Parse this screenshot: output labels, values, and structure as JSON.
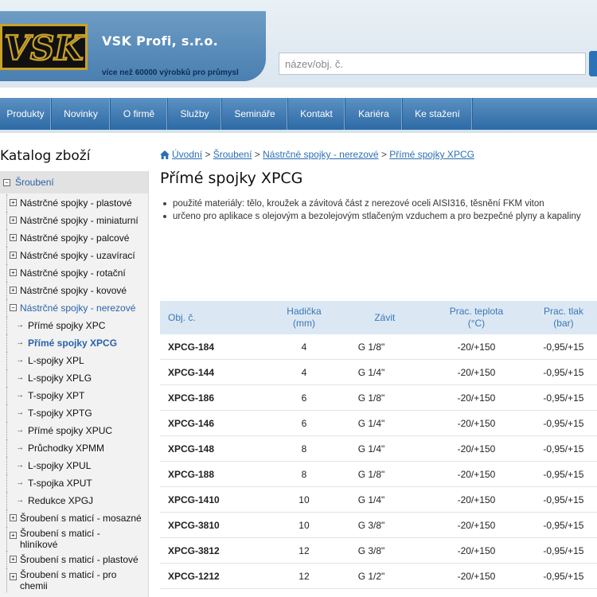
{
  "header": {
    "brand_title": "VSK Profi, s.r.o.",
    "tagline": "více než 60000 výrobků pro průmysl",
    "logo_text": "VSK",
    "search_placeholder": "název/obj. č."
  },
  "nav": [
    "Produkty",
    "Novinky",
    "O firmě",
    "Služby",
    "Semináře",
    "Kontakt",
    "Kariéra",
    "Ke stažení"
  ],
  "sidebar": {
    "title": "Katalog zboží",
    "root": "Šroubení",
    "items": [
      {
        "label": "Nástrčné spojky - plastové",
        "level": 1,
        "state": "normal"
      },
      {
        "label": "Nástrčné spojky - miniaturní",
        "level": 1,
        "state": "normal"
      },
      {
        "label": "Nástrčné spojky - palcové",
        "level": 1,
        "state": "normal"
      },
      {
        "label": "Nástrčné spojky - uzavírací",
        "level": 1,
        "state": "normal"
      },
      {
        "label": "Nástrčné spojky - rotační",
        "level": 1,
        "state": "normal"
      },
      {
        "label": "Nástrčné spojky - kovové",
        "level": 1,
        "state": "normal"
      },
      {
        "label": "Nástrčné spojky - nerezové",
        "level": 1,
        "state": "active"
      },
      {
        "label": "Přímé spojky XPC",
        "level": 2,
        "state": "normal"
      },
      {
        "label": "Přímé spojky XPCG",
        "level": 2,
        "state": "current"
      },
      {
        "label": "L-spojky XPL",
        "level": 2,
        "state": "normal"
      },
      {
        "label": "L-spojky XPLG",
        "level": 2,
        "state": "normal"
      },
      {
        "label": "T-spojky XPT",
        "level": 2,
        "state": "normal"
      },
      {
        "label": "T-spojky XPTG",
        "level": 2,
        "state": "normal"
      },
      {
        "label": "Přímé spojky XPUC",
        "level": 2,
        "state": "normal"
      },
      {
        "label": "Průchodky XPMM",
        "level": 2,
        "state": "normal"
      },
      {
        "label": "L-spojky XPUL",
        "level": 2,
        "state": "normal"
      },
      {
        "label": "T-spojka XPUT",
        "level": 2,
        "state": "normal"
      },
      {
        "label": "Redukce XPGJ",
        "level": 2,
        "state": "normal"
      },
      {
        "label": "Šroubení s maticí - mosazné",
        "level": 1,
        "state": "normal"
      },
      {
        "label": "Šroubení s maticí - hliníkové",
        "level": 1,
        "state": "normal"
      },
      {
        "label": "Šroubení s maticí - plastové",
        "level": 1,
        "state": "normal"
      },
      {
        "label": "Šroubení s maticí - pro chemii",
        "level": 1,
        "state": "normal"
      }
    ]
  },
  "breadcrumb": {
    "items": [
      "Úvodní",
      "Šroubení",
      "Nástrčné spojky - nerezové",
      "Přímé spojky XPCG"
    ],
    "separator": ">"
  },
  "page": {
    "title": "Přímé spojky XPCG",
    "bullets": [
      "použité materiály: tělo, kroužek a závitová část z nerezové oceli AISI316, těsnění FKM viton",
      "určeno pro aplikace s olejovým a bezolejovým stlačeným vzduchem a pro bezpečné plyny a kapaliny"
    ]
  },
  "table": {
    "headers": [
      {
        "line1": "Obj. č.",
        "line2": ""
      },
      {
        "line1": "Hadička",
        "line2": "(mm)"
      },
      {
        "line1": "Závit",
        "line2": ""
      },
      {
        "line1": "Prac. teplota",
        "line2": "(°C)"
      },
      {
        "line1": "Prac. tlak",
        "line2": "(bar)"
      }
    ],
    "rows": [
      [
        "XPCG-184",
        "4",
        "G 1/8\"",
        "-20/+150",
        "-0,95/+15"
      ],
      [
        "XPCG-144",
        "4",
        "G 1/4\"",
        "-20/+150",
        "-0,95/+15"
      ],
      [
        "XPCG-186",
        "6",
        "G 1/8\"",
        "-20/+150",
        "-0,95/+15"
      ],
      [
        "XPCG-146",
        "6",
        "G 1/4\"",
        "-20/+150",
        "-0,95/+15"
      ],
      [
        "XPCG-148",
        "8",
        "G 1/4\"",
        "-20/+150",
        "-0,95/+15"
      ],
      [
        "XPCG-188",
        "8",
        "G 1/8\"",
        "-20/+150",
        "-0,95/+15"
      ],
      [
        "XPCG-1410",
        "10",
        "G 1/4\"",
        "-20/+150",
        "-0,95/+15"
      ],
      [
        "XPCG-3810",
        "10",
        "G 3/8\"",
        "-20/+150",
        "-0,95/+15"
      ],
      [
        "XPCG-3812",
        "12",
        "G 3/8\"",
        "-20/+150",
        "-0,95/+15"
      ],
      [
        "XPCG-1212",
        "12",
        "G 1/2\"",
        "-20/+150",
        "-0,95/+15"
      ]
    ]
  },
  "colors": {
    "nav_bg": "#2d6aa5",
    "link": "#2a6fb5",
    "header_row": "#dbe8f4",
    "logo_gold": "#c9a227"
  }
}
